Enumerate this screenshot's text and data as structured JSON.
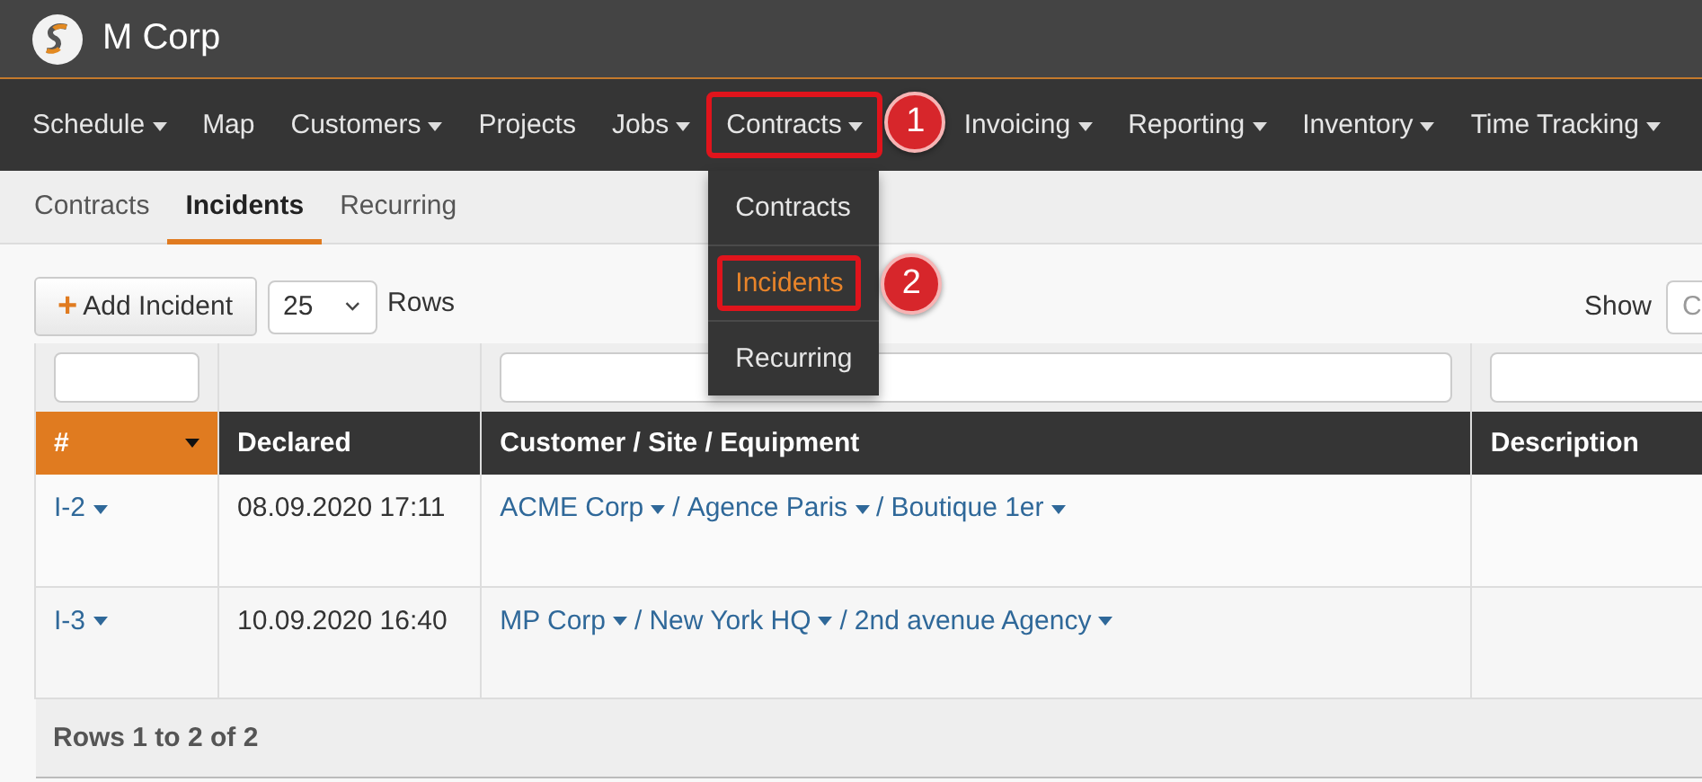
{
  "app": {
    "title": "M Corp"
  },
  "nav": [
    {
      "label": "Schedule",
      "has_menu": true,
      "highlighted": false
    },
    {
      "label": "Map",
      "has_menu": false,
      "highlighted": false
    },
    {
      "label": "Customers",
      "has_menu": true,
      "highlighted": false
    },
    {
      "label": "Projects",
      "has_menu": false,
      "highlighted": false
    },
    {
      "label": "Jobs",
      "has_menu": true,
      "highlighted": false
    },
    {
      "label": "Contracts",
      "has_menu": true,
      "highlighted": true,
      "callout": "1",
      "menu": [
        {
          "label": "Contracts",
          "selected": false,
          "highlighted": false
        },
        {
          "label": "Incidents",
          "selected": true,
          "highlighted": true,
          "callout": "2"
        },
        {
          "label": "Recurring",
          "selected": false,
          "highlighted": false
        }
      ]
    },
    {
      "label": "Invoicing",
      "has_menu": true,
      "highlighted": false
    },
    {
      "label": "Reporting",
      "has_menu": true,
      "highlighted": false
    },
    {
      "label": "Inventory",
      "has_menu": true,
      "highlighted": false
    },
    {
      "label": "Time Tracking",
      "has_menu": true,
      "highlighted": false
    }
  ],
  "subnav": [
    {
      "label": "Contracts",
      "selected": false
    },
    {
      "label": "Incidents",
      "selected": true
    },
    {
      "label": "Recurring",
      "selected": false
    }
  ],
  "toolbar": {
    "add_icon": "+",
    "add_button": "Add Incident",
    "page_size": "25",
    "page_size_label": "Rows",
    "show_label": "Show",
    "show_value": "C"
  },
  "table": {
    "columns": [
      {
        "label": "#",
        "sorted": true,
        "filter": true
      },
      {
        "label": "Declared",
        "sorted": false,
        "filter": false
      },
      {
        "label": "Customer / Site / Equipment",
        "sorted": false,
        "filter": true
      },
      {
        "label": "Description",
        "sorted": false,
        "filter": true
      }
    ],
    "separator": "/",
    "rows": [
      {
        "id": "I-2",
        "declared": "08.09.2020 17:11",
        "path": [
          "ACME Corp",
          "Agence Paris",
          "Boutique 1er"
        ]
      },
      {
        "id": "I-3",
        "declared": "10.09.2020 16:40",
        "path": [
          "MP Corp",
          "New York HQ",
          "2nd avenue Agency"
        ]
      }
    ],
    "footer": "Rows 1 to 2 of 2"
  }
}
